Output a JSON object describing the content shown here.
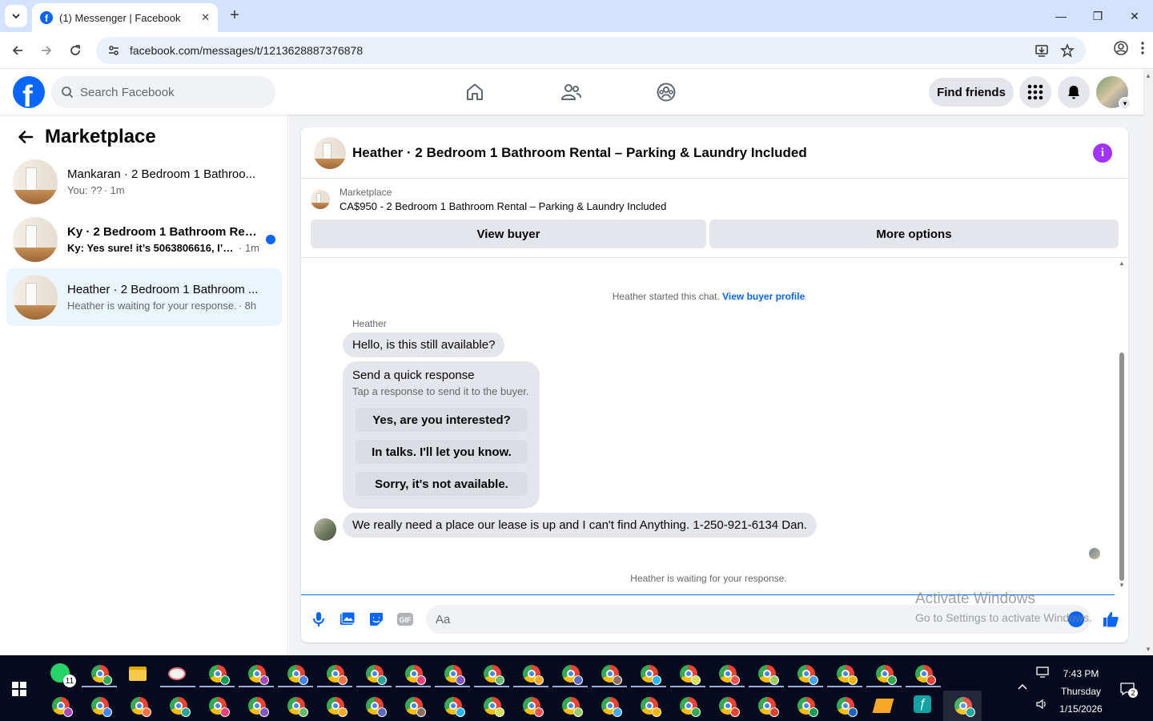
{
  "browser": {
    "tab_title": "(1) Messenger | Facebook",
    "url": "facebook.com/messages/t/1213628887376878"
  },
  "fb": {
    "search_placeholder": "Search Facebook",
    "find_friends": "Find friends",
    "nav": [
      "home-icon",
      "friends-icon",
      "groups-icon"
    ]
  },
  "sidebar": {
    "title": "Marketplace",
    "conversations": [
      {
        "name": "Mankaran · 2 Bedroom 1 Bathroo...",
        "preview": "You: ??",
        "time": " · 1m",
        "unread": false,
        "active": false
      },
      {
        "name": "Ky · 2 Bedroom 1 Bathroom Rent...",
        "preview": "Ky: Yes sure! it’s 5063806616, I’m a...",
        "time": " · 1m",
        "unread": true,
        "active": false
      },
      {
        "name": "Heather · 2 Bedroom 1 Bathroom ...",
        "preview": "Heather is waiting for your response.",
        "time": " · 8h",
        "unread": false,
        "active": true
      }
    ]
  },
  "chat": {
    "title": "Heather · 2 Bedroom 1 Bathroom Rental – Parking & Laundry Included",
    "listing_label": "Marketplace",
    "listing_text": "CA$950 - 2 Bedroom 1 Bathroom Rental – Parking & Laundry Included",
    "view_buyer": "View buyer",
    "more_options": "More options",
    "started_text": "Heather started this chat. ",
    "view_buyer_profile": "View buyer profile",
    "sender_name": "Heather",
    "message_1": "Hello, is this still available?",
    "quick_title": "Send a quick response",
    "quick_sub": "Tap a response to send it to the buyer.",
    "quick_replies": [
      "Yes, are you interested?",
      "In talks. I'll let you know.",
      "Sorry, it's not available."
    ],
    "message_2": "We really need a place our lease is up and I can't find Anything. 1-250-921-6134 Dan.",
    "waiting": "Heather is waiting for your response.",
    "input_placeholder": "Aa"
  },
  "watermark": {
    "line1": "Activate Windows",
    "line2": "Go to Settings to activate Windows."
  },
  "taskbar": {
    "whatsapp_badge": "11",
    "time": "7:43 PM",
    "day": "Thursday",
    "date": "1/15/2026",
    "notif_count": "2"
  },
  "colors": {
    "fb_blue": "#0866ff",
    "info_purple": "#a033ff",
    "active_conv": "#ebf5ff"
  }
}
